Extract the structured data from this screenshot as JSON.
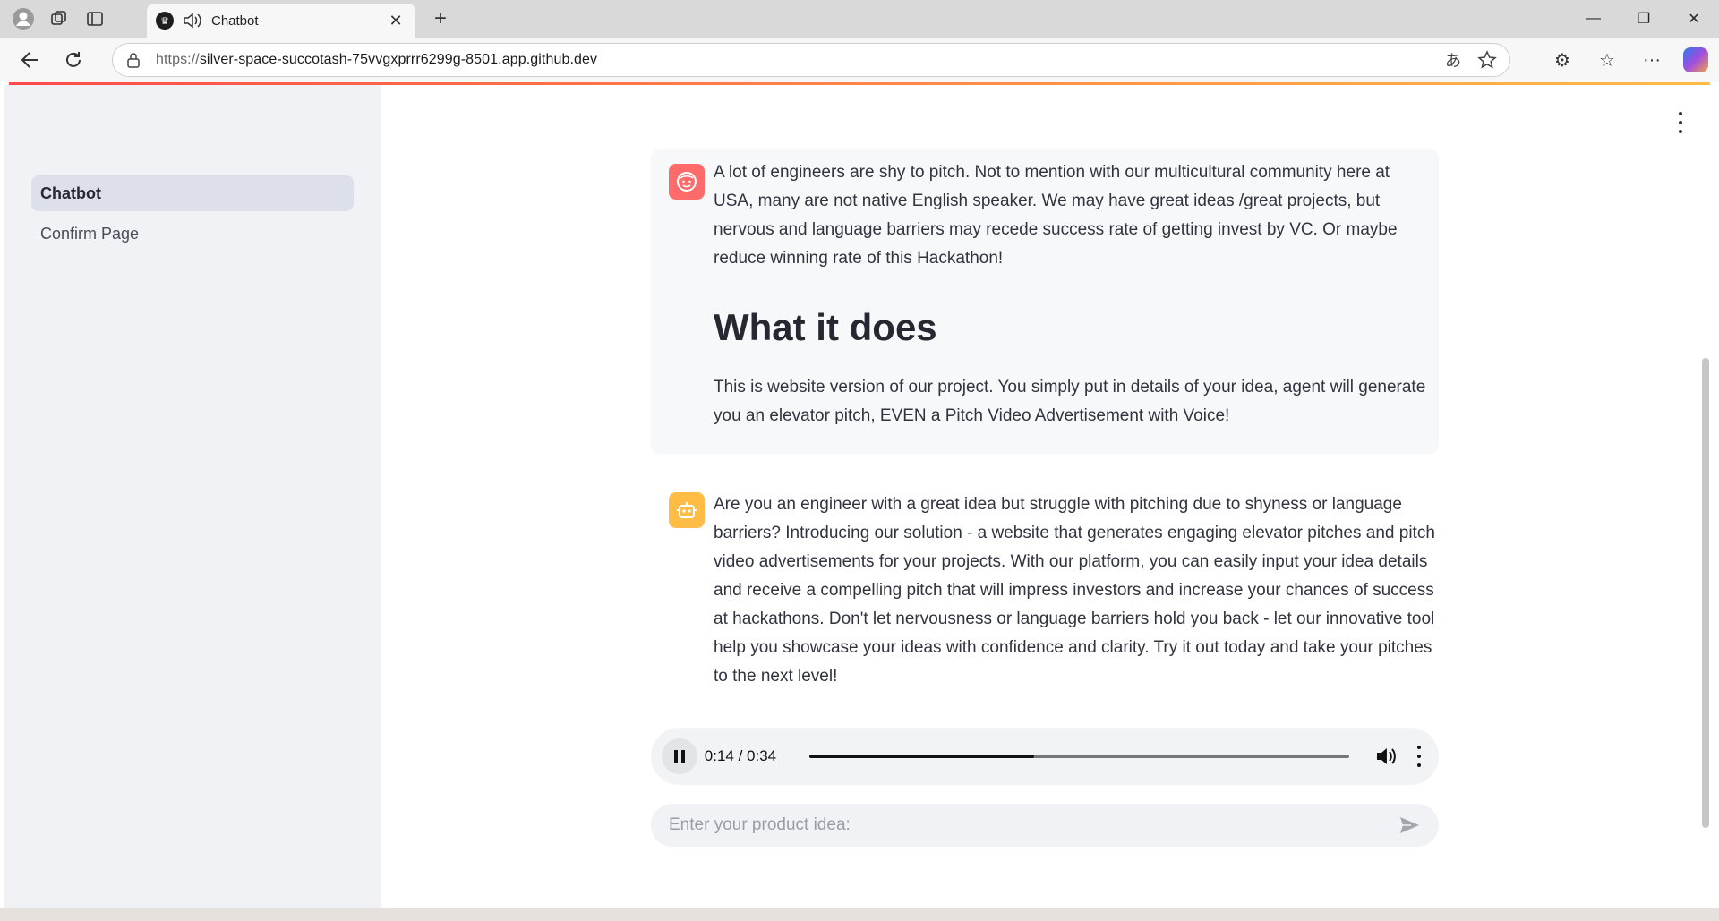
{
  "browser": {
    "tab_title": "Chatbot",
    "url_scheme": "https://",
    "url_host": "silver-space-succotash-75vvgxprrr6299g-8501.app.github.dev",
    "new_tab_symbol": "+",
    "close_symbol": "✕"
  },
  "sidebar": {
    "items": [
      {
        "label": "Chatbot",
        "active": true
      },
      {
        "label": "Confirm Page",
        "active": false
      }
    ]
  },
  "chat": {
    "user_message": {
      "paragraph1": "A lot of engineers are shy to pitch. Not to mention with our multicultural community here at USA, many are not native English speaker. We may have great ideas /great projects, but nervous and language barriers may recede success rate of getting invest by VC. Or maybe reduce winning rate of this Hackathon!",
      "heading": "What it does",
      "paragraph2": "This is website version of our project. You simply put in details of your idea, agent will generate you an elevator pitch, EVEN a Pitch Video Advertisement with Voice!"
    },
    "assistant_message": "Are you an engineer with a great idea but struggle with pitching due to shyness or language barriers? Introducing our solution - a website that generates engaging elevator pitches and pitch video advertisements for your projects. With our platform, you can easily input your idea details and receive a compelling pitch that will impress investors and increase your chances of success at hackathons. Don't let nervousness or language barriers hold you back - let our innovative tool help you showcase your ideas with confidence and clarity. Try it out today and take your pitches to the next level!"
  },
  "audio": {
    "time_display": "0:14 / 0:34",
    "progress_fraction": 0.415
  },
  "input": {
    "placeholder": "Enter your product idea:"
  },
  "colors": {
    "accent_start": "#ff4b4b",
    "accent_end": "#ffbd45",
    "user_avatar": "#ff6b6b",
    "bot_avatar": "#ffbd45"
  },
  "icons": [
    "profile-icon",
    "workspaces-icon",
    "tab-actions-icon",
    "streamlit-favicon",
    "speaker-icon",
    "back-icon",
    "reload-icon",
    "lock-icon",
    "translate-icon",
    "star-icon",
    "extensions-icon",
    "favorites-icon",
    "more-icon",
    "copilot-icon",
    "kebab-icon",
    "face-icon",
    "robot-icon",
    "pause-icon",
    "volume-icon",
    "send-icon"
  ]
}
